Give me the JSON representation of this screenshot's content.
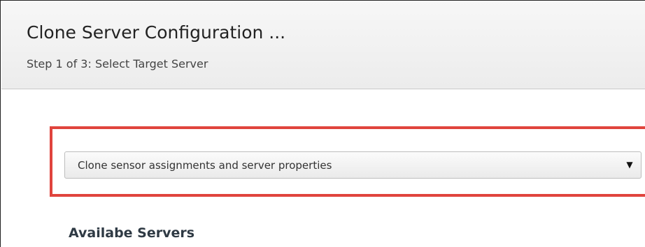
{
  "dialog": {
    "title": "Clone Server Configuration ...",
    "subtitle": "Step 1 of 3: Select Target Server"
  },
  "clone_mode_select": {
    "selected_value": "Clone sensor assignments and server properties",
    "arrow_icon": "▼",
    "arrow_icon_name": "chevron-down-icon"
  },
  "servers_section": {
    "heading": "Availabe Servers"
  },
  "colors": {
    "highlight": "#e0443d",
    "header_background": "#f0f0f0"
  }
}
